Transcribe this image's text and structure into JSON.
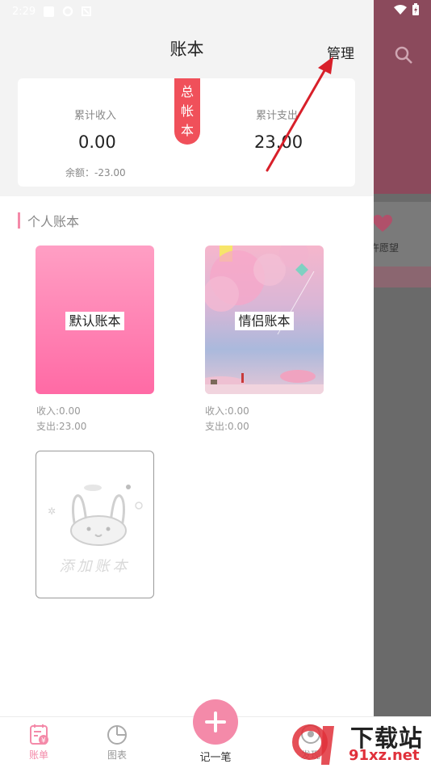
{
  "status_bar": {
    "time": "2:29"
  },
  "header": {
    "title": "账本",
    "manage_label": "管理"
  },
  "summary": {
    "tag_chars": [
      "总",
      "帐",
      "本"
    ],
    "income_label": "累计收入",
    "income_value": "0.00",
    "expense_label": "累计支出",
    "expense_value": "23.00",
    "balance_text": "余额：-23.00"
  },
  "section": {
    "title": "个人账本"
  },
  "books": [
    {
      "name": "默认账本",
      "income": "收入:0.00",
      "expense": "支出:23.00"
    },
    {
      "name": "情侣账本",
      "income": "收入:0.00",
      "expense": "支出:0.00"
    }
  ],
  "add_book": {
    "label": "添加账本"
  },
  "background": {
    "wish_label": "许愿望"
  },
  "nav": {
    "items": [
      {
        "label": "账单",
        "icon": "bill-icon"
      },
      {
        "label": "图表",
        "icon": "chart-icon"
      },
      {
        "label": "记一笔",
        "icon": "plus-icon"
      },
      {
        "label": "发现",
        "icon": "discover-icon"
      }
    ]
  },
  "watermark": {
    "text": "下载站",
    "url": "91xz.net"
  },
  "colors": {
    "accent": "#f48aa9",
    "tag": "#f0505a",
    "arrow": "#d8202a"
  }
}
